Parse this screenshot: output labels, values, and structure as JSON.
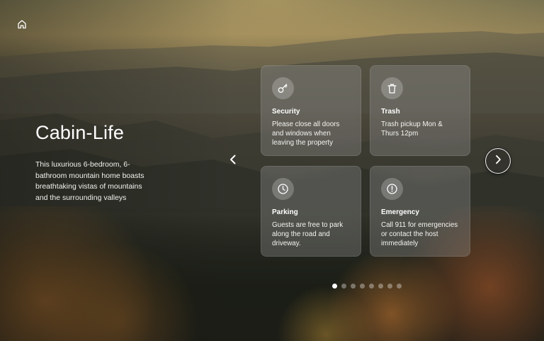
{
  "header": {
    "home_icon": "home-icon"
  },
  "hero": {
    "title": "Cabin-Life",
    "description": "This luxurious 6-bedroom, 6-bathroom mountain home boasts breathtaking vistas of mountains and the surrounding valleys"
  },
  "cards": [
    {
      "icon": "key-icon",
      "title": "Security",
      "text": "Please close all doors and windows when leaving the property"
    },
    {
      "icon": "trash-icon",
      "title": "Trash",
      "text": "Trash pickup Mon & Thurs 12pm"
    },
    {
      "icon": "clock-icon",
      "title": "Parking",
      "text": "Guests are free to park along the road and driveway."
    },
    {
      "icon": "alert-icon",
      "title": "Emergency",
      "text": "Call 911 for emergencies or contact the host immediately"
    }
  ],
  "carousel": {
    "page_count": 8,
    "active_page": 1,
    "prev_icon": "chevron-left-icon",
    "next_icon": "chevron-right-icon"
  }
}
